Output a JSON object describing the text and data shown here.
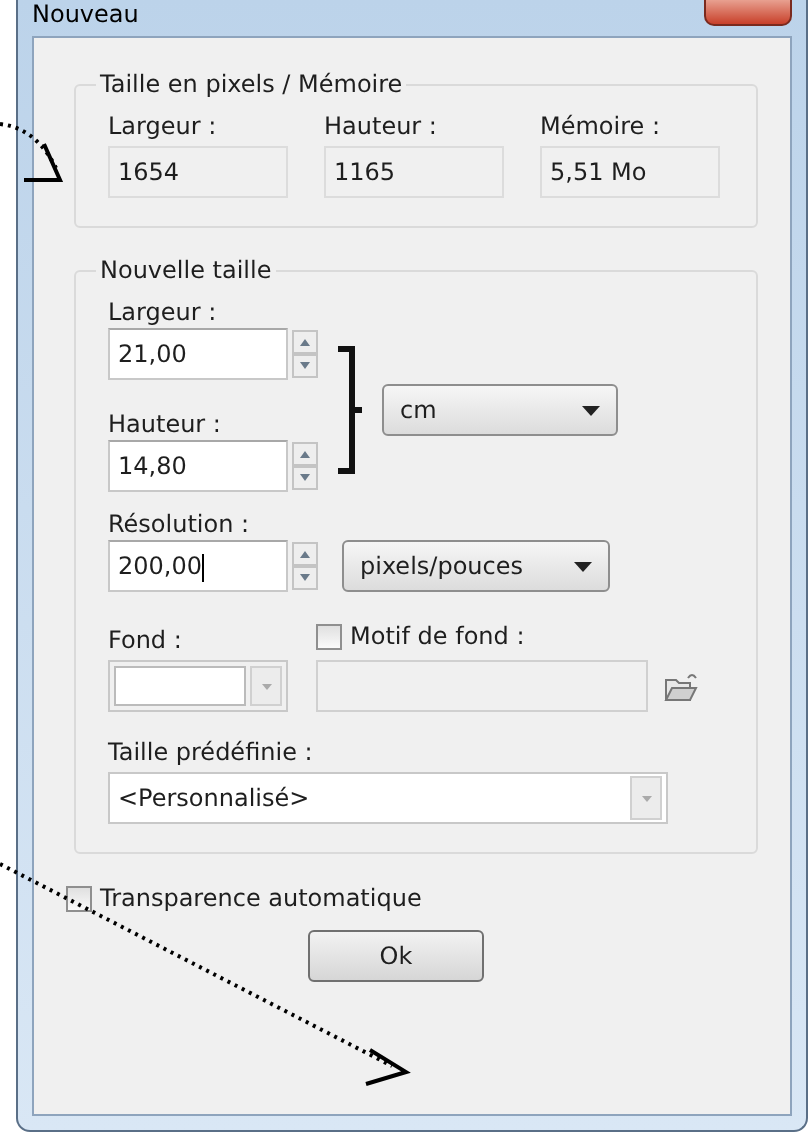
{
  "window": {
    "title": "Nouveau"
  },
  "pixel_group": {
    "title": "Taille en pixels / Mémoire",
    "fields": [
      {
        "label": "Largeur :",
        "value": "1654"
      },
      {
        "label": "Hauteur :",
        "value": "1165"
      },
      {
        "label": "Mémoire :",
        "value": "5,51 Mo"
      }
    ]
  },
  "new_size": {
    "title": "Nouvelle taille",
    "width": {
      "label": "Largeur :",
      "value": "21,00"
    },
    "height": {
      "label": "Hauteur :",
      "value": "14,80"
    },
    "unit": {
      "value": "cm"
    },
    "resolution": {
      "label": "Résolution :",
      "value": "200,00",
      "focused": true
    },
    "resolution_unit": {
      "value": "pixels/pouces"
    },
    "background": {
      "label": "Fond :"
    },
    "pattern": {
      "label": "Motif de fond :",
      "checked": false
    },
    "preset": {
      "label": "Taille prédéfinie :",
      "value": "<Personnalisé>"
    }
  },
  "auto_transparency": {
    "label": "Transparence automatique",
    "checked": false
  },
  "buttons": [
    {
      "label": "Ok"
    }
  ]
}
